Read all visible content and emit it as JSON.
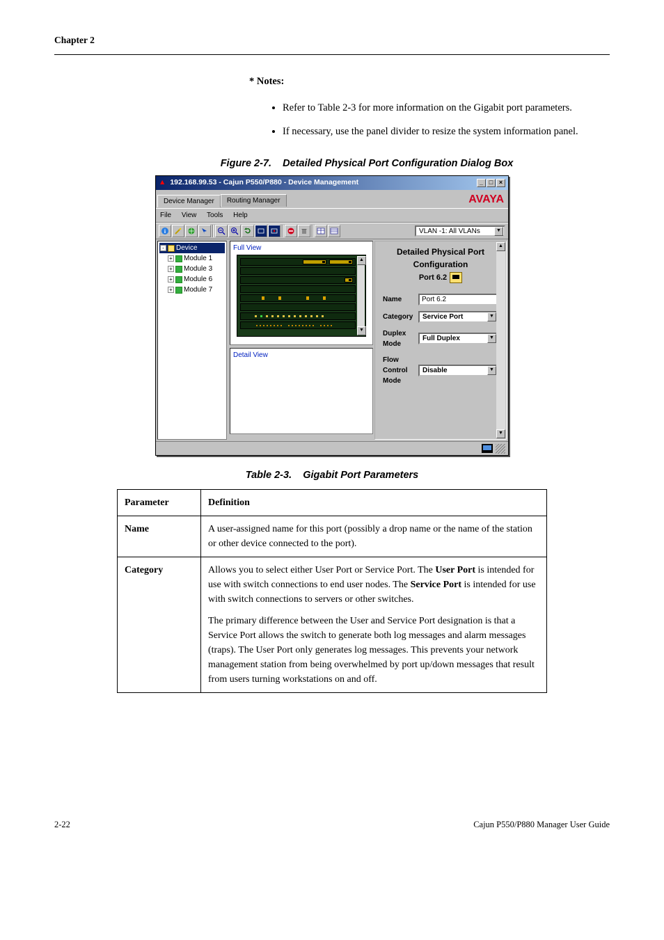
{
  "chapter": "Chapter 2",
  "notes_heading": "* Notes:",
  "notes": [
    "Refer to Table 2-3 for more information on the Gigabit port parameters.",
    "If necessary, use the panel divider to resize the system information panel."
  ],
  "figure_caption_num": "Figure 2-7.",
  "figure_caption_title": "Detailed Physical Port Configuration Dialog Box",
  "table_caption_num": "Table 2-3.",
  "table_caption_title": "Gigabit Port Parameters",
  "screenshot": {
    "window_title": "192.168.99.53 - Cajun P550/P880 -   Device Management",
    "brand": "AVAYA",
    "tabs": {
      "device_manager": "Device Manager",
      "routing_manager": "Routing Manager"
    },
    "menus": {
      "file": "File",
      "view": "View",
      "tools": "Tools",
      "help": "Help"
    },
    "toolbar_right_label": "VLAN -1: All VLANs",
    "tree": {
      "root": "Device",
      "items": [
        "Module 1",
        "Module 3",
        "Module 6",
        "Module 7"
      ]
    },
    "full_view_label": "Full View",
    "detail_view_label": "Detail View",
    "right": {
      "title": "Detailed Physical Port Configuration",
      "port_label": "Port 6.2",
      "rows": {
        "name": {
          "label": "Name",
          "value": "Port 6.2"
        },
        "category": {
          "label": "Category",
          "value": "Service Port"
        },
        "duplex": {
          "label": "Duplex Mode",
          "value": "Full Duplex"
        },
        "flow": {
          "label": "Flow Control Mode",
          "value": "Disable"
        }
      }
    }
  },
  "param_table": {
    "headers": {
      "parameter": "Parameter",
      "definition": "Definition"
    },
    "rows": {
      "name": {
        "param": "Name",
        "def": "A user-assigned name for this port (possibly a drop name or the name of the station or other device connected to the port)."
      },
      "category": {
        "param": "Category",
        "def_p1_pre": "Allows you to select either User Port or Service Port. The ",
        "def_p1_b1": "User Port",
        "def_p1_mid": " is intended for use with switch connections to end user nodes. The ",
        "def_p1_b2": "Service Port",
        "def_p1_post": " is intended for use with switch connections to servers or other switches.",
        "def_p2": "The primary difference between the User and Service Port designation is that a Service Port allows the switch to generate both log messages and alarm messages (traps). The User Port only generates log messages. This prevents your network management station from being overwhelmed by port up/down messages that result from users turning workstations on and off."
      }
    }
  },
  "footer": {
    "left": "2-22",
    "right": "Cajun P550/P880 Manager User Guide"
  }
}
